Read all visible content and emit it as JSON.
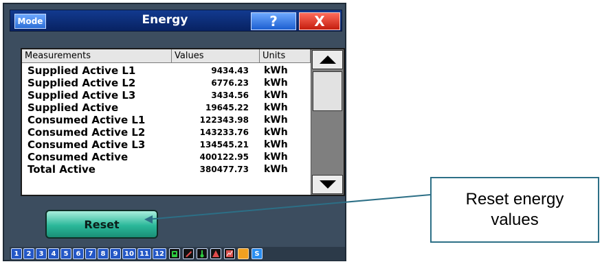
{
  "window": {
    "title": "Energy",
    "mode_label": "Mode",
    "help_label": "?",
    "close_label": "X"
  },
  "table": {
    "headers": [
      "Measurements",
      "Values",
      "Units"
    ],
    "rows": [
      {
        "measurement": "Supplied Active L1",
        "value": "9434.43",
        "unit": "kWh"
      },
      {
        "measurement": "Supplied Active L2",
        "value": "6776.23",
        "unit": "kWh"
      },
      {
        "measurement": "Supplied Active L3",
        "value": "3434.56",
        "unit": "kWh"
      },
      {
        "measurement": "Supplied Active",
        "value": "19645.22",
        "unit": "kWh"
      },
      {
        "measurement": "Consumed Active L1",
        "value": "122343.98",
        "unit": "kWh"
      },
      {
        "measurement": "Consumed Active L2",
        "value": "143233.76",
        "unit": "kWh"
      },
      {
        "measurement": "Consumed Active L3",
        "value": "134545.21",
        "unit": "kWh"
      },
      {
        "measurement": "Consumed Active",
        "value": "400122.95",
        "unit": "kWh"
      },
      {
        "measurement": "Total Active",
        "value": "380477.73",
        "unit": "kWh"
      }
    ]
  },
  "reset_button": {
    "label": "Reset"
  },
  "taskbar": {
    "numbers": [
      "1",
      "2",
      "3",
      "4",
      "5",
      "6",
      "7",
      "8",
      "9",
      "10",
      "11",
      "12"
    ],
    "icons": [
      "phone-icon",
      "wrench-icon",
      "thermometer-icon",
      "warning-icon",
      "chart-icon",
      "orange-square-icon",
      "settings-s-icon"
    ],
    "s_label": "S"
  },
  "callout": {
    "text": "Reset energy\nvalues"
  },
  "colors": {
    "accent_blue": "#1c5fd0",
    "close_red": "#c41d0e",
    "reset_green": "#2bb89a",
    "callout_border": "#2c6f86"
  }
}
